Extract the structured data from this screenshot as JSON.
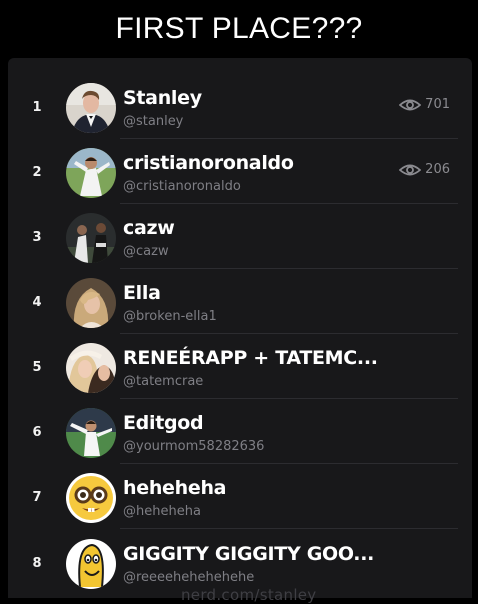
{
  "caption": "FIRST PLACE???",
  "colors": {
    "background": "#000000",
    "panel": "#18181a",
    "text": "#ffffff",
    "muted": "#7f7f85"
  },
  "watermark": "nerd.com/stanley",
  "leaderboard": [
    {
      "rank": "1",
      "name": "Stanley",
      "handle": "@stanley",
      "views": "701",
      "avatar_icon": "person-suit-avatar"
    },
    {
      "rank": "2",
      "name": "cristianoronaldo",
      "handle": "@cristianoronaldo",
      "views": "206",
      "avatar_icon": "soccer-player-avatar"
    },
    {
      "rank": "3",
      "name": "cazw",
      "handle": "@cazw",
      "views": "",
      "avatar_icon": "players-avatar"
    },
    {
      "rank": "4",
      "name": "Ella",
      "handle": "@broken-ella1",
      "views": "",
      "avatar_icon": "blonde-woman-avatar"
    },
    {
      "rank": "5",
      "name": "RENEÉRAPP + TATEMC...",
      "handle": "@tatemcrae",
      "views": "",
      "avatar_icon": "two-women-avatar"
    },
    {
      "rank": "6",
      "name": "Editgod",
      "handle": "@yourmom58282636",
      "views": "",
      "avatar_icon": "soccer-celebration-avatar"
    },
    {
      "rank": "7",
      "name": "heheheha",
      "handle": "@heheheha",
      "views": "",
      "avatar_icon": "nerd-emoji-avatar"
    },
    {
      "rank": "8",
      "name": "GIGGITY GIGGITY GOO...",
      "handle": "@reeeehehehehehe",
      "views": "",
      "avatar_icon": "cartoon-character-avatar"
    }
  ]
}
